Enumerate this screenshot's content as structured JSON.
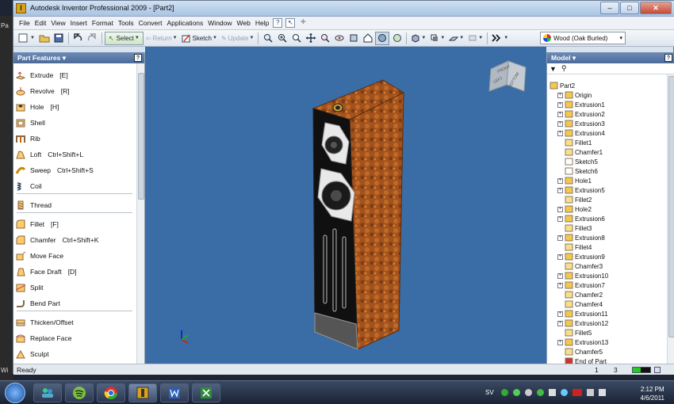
{
  "window": {
    "title": "Autodesk Inventor Professional 2009 - [Part2]",
    "app_icon": "I",
    "controls": {
      "minimize": "–",
      "maximize": "□",
      "close": "✕"
    }
  },
  "edge_text": [
    "Pa",
    "Wi"
  ],
  "menu": {
    "items": [
      "File",
      "Edit",
      "View",
      "Insert",
      "Format",
      "Tools",
      "Convert",
      "Applications",
      "Window",
      "Web",
      "Help"
    ],
    "help_icon": "?",
    "pointer_icon": "↖",
    "plus": "✚"
  },
  "toolbar": {
    "select_label": "Select",
    "return_label": "Return",
    "sketch_label": "Sketch",
    "update_label": "Update"
  },
  "material": {
    "value": "Wood (Oak Burled)",
    "arrow": "▾"
  },
  "part_features": {
    "title": "Part Features ▾",
    "help": "?",
    "items": [
      {
        "label": "Extrude",
        "shortcut": "[E]"
      },
      {
        "label": "Revolve",
        "shortcut": "[R]"
      },
      {
        "label": "Hole",
        "shortcut": "[H]"
      },
      {
        "label": "Shell",
        "shortcut": ""
      },
      {
        "label": "Rib",
        "shortcut": ""
      },
      {
        "label": "Loft",
        "shortcut": "Ctrl+Shift+L"
      },
      {
        "label": "Sweep",
        "shortcut": "Ctrl+Shift+S"
      },
      {
        "label": "Coil",
        "shortcut": ""
      },
      {
        "label": "Thread",
        "shortcut": ""
      },
      {
        "label": "Fillet",
        "shortcut": "[F]"
      },
      {
        "label": "Chamfer",
        "shortcut": "Ctrl+Shift+K"
      },
      {
        "label": "Move Face",
        "shortcut": ""
      },
      {
        "label": "Face Draft",
        "shortcut": "[D]"
      },
      {
        "label": "Split",
        "shortcut": ""
      },
      {
        "label": "Bend Part",
        "shortcut": ""
      },
      {
        "label": "Thicken/Offset",
        "shortcut": ""
      },
      {
        "label": "Replace Face",
        "shortcut": ""
      },
      {
        "label": "Sculpt",
        "shortcut": ""
      }
    ]
  },
  "viewcube": {
    "face_front": "FRONT",
    "face_left": "LEFT",
    "face_bottom": "BOTTOM"
  },
  "model": {
    "title": "Model ▾",
    "help": "?",
    "filter_icon": "▼",
    "find_icon": "⚲",
    "root": "Part2",
    "expand": "+",
    "items": [
      "Origin",
      "Extrusion1",
      "Extrusion2",
      "Extrusion3",
      "Extrusion4",
      "Fillet1",
      "Chamfer1",
      "Sketch5",
      "Sketch6",
      "Hole1",
      "Extrusion5",
      "Fillet2",
      "Hole2",
      "Extrusion6",
      "Fillet3",
      "Extrusion8",
      "Fillet4",
      "Extrusion9",
      "Chamfer3",
      "Extrusion10",
      "Extrusion7",
      "Chamfer2",
      "Chamfer4",
      "Extrusion11",
      "Extrusion12",
      "Fillet5",
      "Extrusion13",
      "Chamfer5",
      "End of Part"
    ],
    "expandable": [
      true,
      true,
      true,
      true,
      true,
      false,
      false,
      false,
      false,
      true,
      true,
      false,
      true,
      true,
      false,
      true,
      false,
      true,
      false,
      true,
      true,
      false,
      false,
      true,
      true,
      false,
      true,
      false,
      false
    ]
  },
  "status": {
    "text": "Ready",
    "num1": "1",
    "num2": "3"
  },
  "taskbar": {
    "time": "2:12 PM",
    "date": "4/6/2011",
    "lang": "SV"
  }
}
